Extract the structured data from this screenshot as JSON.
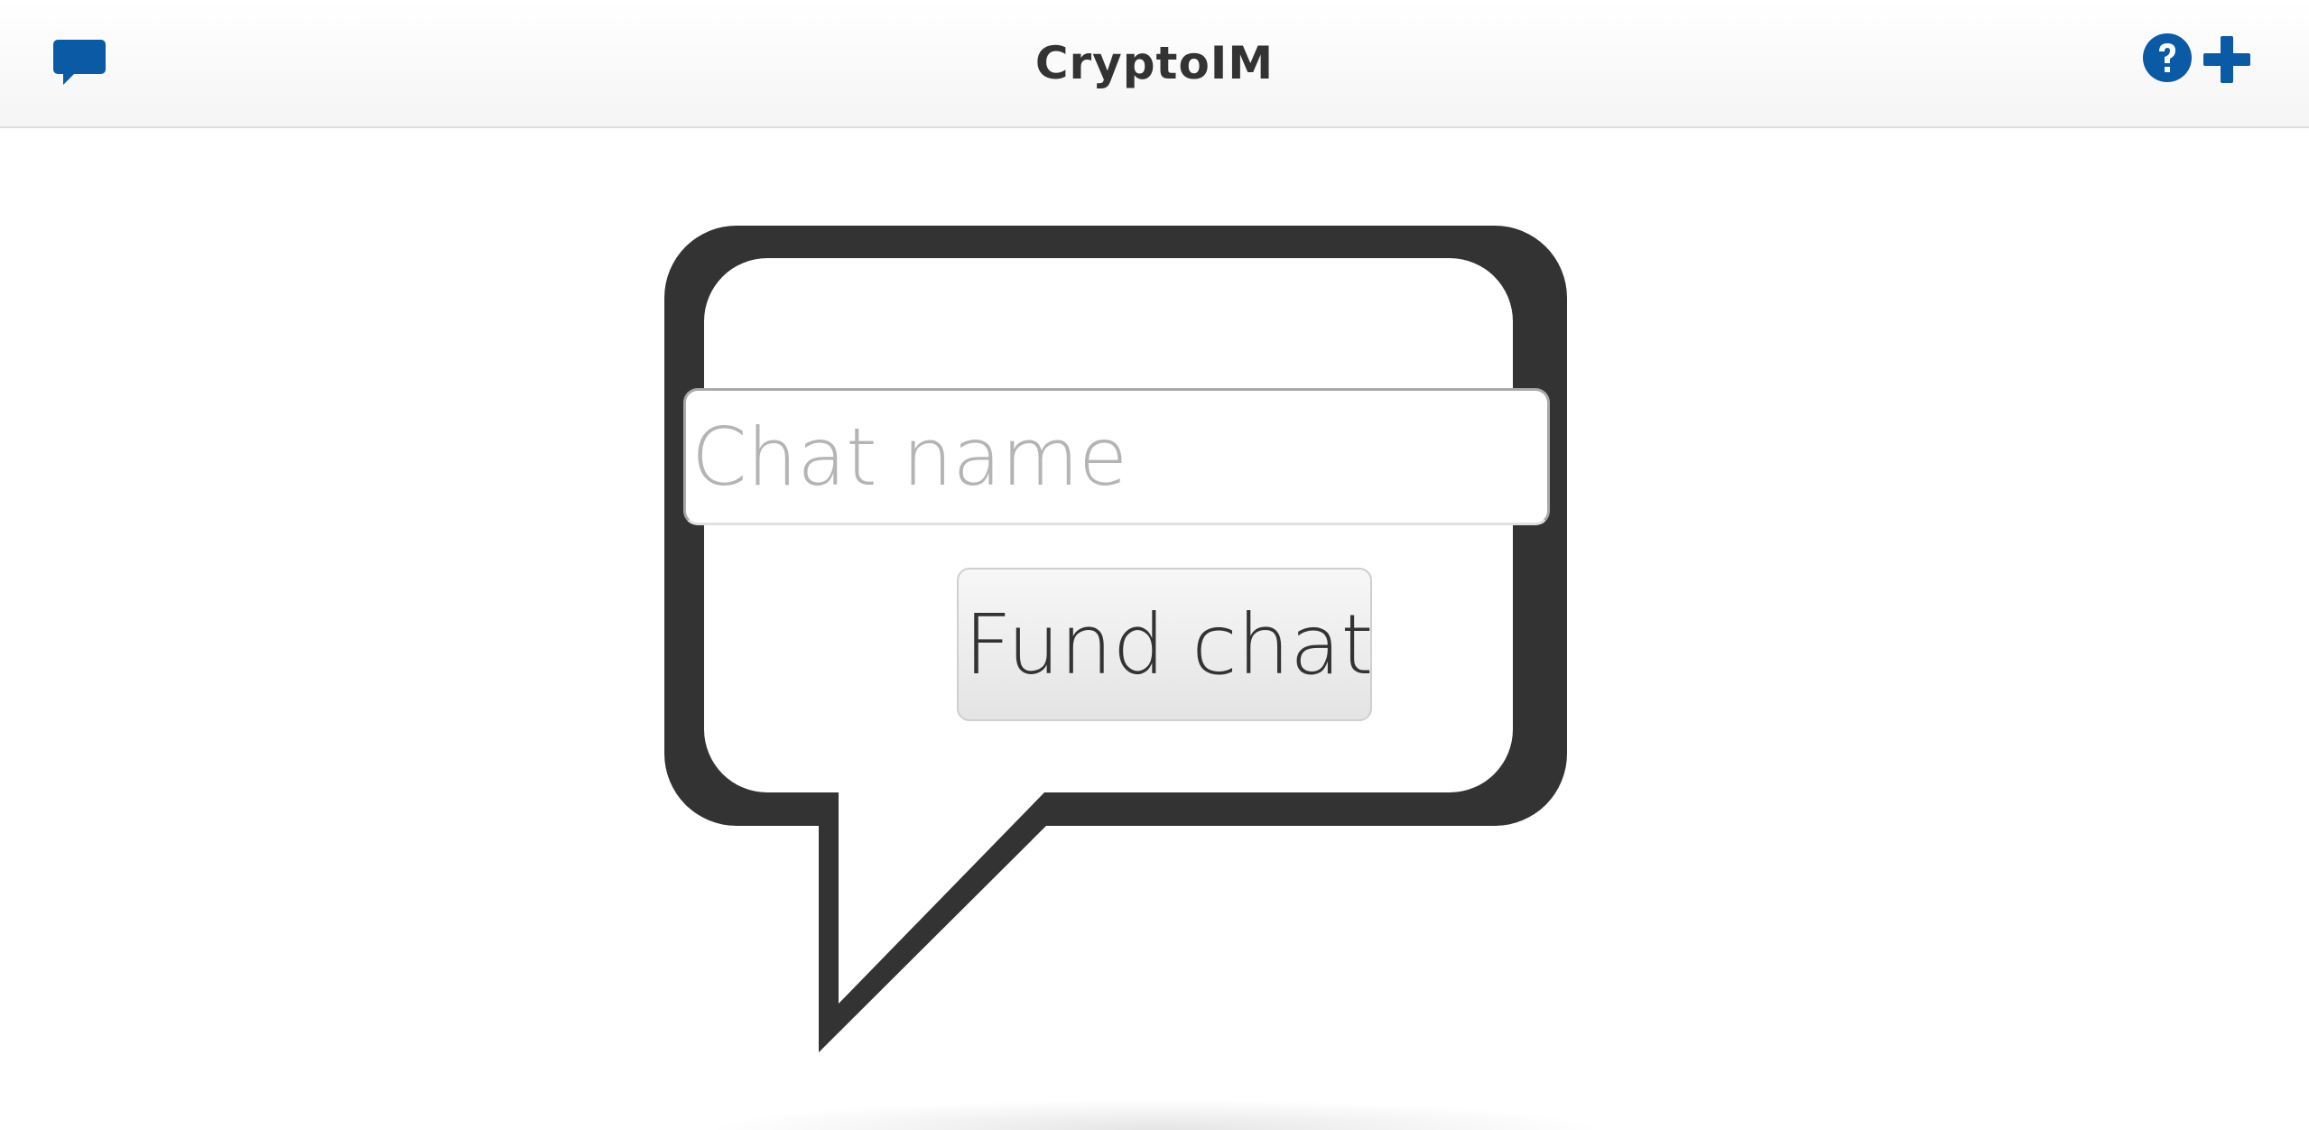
{
  "header": {
    "title": "CryptoIM",
    "left_icon": "chat-bubble-icon",
    "right_icons": [
      "help-icon",
      "plus-icon"
    ]
  },
  "form": {
    "chat_name_placeholder": "Chat name",
    "chat_name_value": "",
    "fund_button_label": "Fund chat"
  },
  "colors": {
    "accent": "#0b5aa5",
    "bubble_border": "#333333",
    "title_text": "#333333",
    "placeholder_text": "#b4b4b4"
  }
}
